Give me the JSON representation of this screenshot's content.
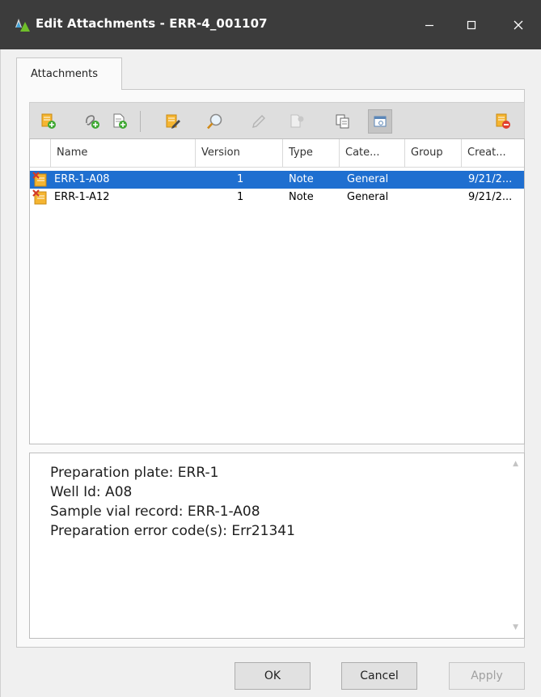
{
  "window": {
    "title": "Edit Attachments - ERR-4_001107",
    "minimize_icon": "minimize-icon",
    "maximize_icon": "maximize-icon",
    "close_icon": "close-icon"
  },
  "tabs": [
    {
      "label": "Attachments",
      "selected": true
    }
  ],
  "toolbar": {
    "buttons": [
      {
        "icon": "add-attachment-icon",
        "enabled": true
      },
      {
        "icon": "add-link-icon",
        "enabled": true
      },
      {
        "icon": "add-document-icon",
        "enabled": true
      },
      {
        "icon": "edit-note-icon",
        "enabled": true
      },
      {
        "icon": "search-icon",
        "enabled": true
      },
      {
        "icon": "pencil-icon",
        "enabled": false
      },
      {
        "icon": "document-settings-icon",
        "enabled": false
      },
      {
        "icon": "copy-icon",
        "enabled": true
      },
      {
        "icon": "preview-pane-icon",
        "enabled": true,
        "active": true
      },
      {
        "icon": "remove-attachment-icon",
        "enabled": true
      }
    ]
  },
  "grid": {
    "columns": [
      "Name",
      "Version",
      "Type",
      "Cate...",
      "Group",
      "Creat..."
    ],
    "rows": [
      {
        "name": "ERR-1-A08",
        "version": "1",
        "type": "Note",
        "category": "General",
        "group": "",
        "created": "9/21/2...",
        "selected": true
      },
      {
        "name": "ERR-1-A12",
        "version": "1",
        "type": "Note",
        "category": "General",
        "group": "",
        "created": "9/21/2...",
        "selected": false
      }
    ]
  },
  "notes": {
    "lines": [
      "Preparation plate: ERR-1",
      "Well Id: A08",
      "Sample vial record: ERR-1-A08",
      "Preparation error code(s): Err21341"
    ]
  },
  "buttons": {
    "ok": "OK",
    "cancel": "Cancel",
    "apply": "Apply"
  },
  "colors": {
    "titlebar": "#3c3c3c",
    "selection": "#1f6fd0"
  }
}
